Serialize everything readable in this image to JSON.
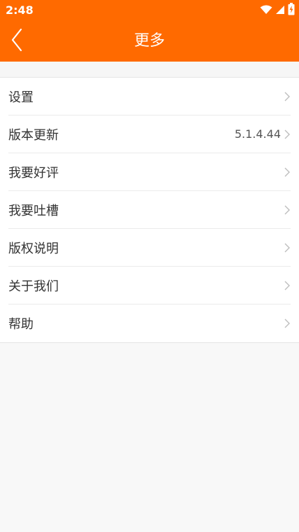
{
  "status_bar": {
    "time": "2:48",
    "icons": [
      "wifi-icon",
      "signal-icon",
      "battery-charging-icon"
    ]
  },
  "header": {
    "title": "更多",
    "back_icon": "chevron-left-icon"
  },
  "colors": {
    "accent": "#ff6a00",
    "background": "#f8f8f8",
    "item_text": "#333333",
    "chevron": "#bdbdbd"
  },
  "menu": {
    "items": [
      {
        "label": "设置",
        "value": ""
      },
      {
        "label": "版本更新",
        "value": "5.1.4.44"
      },
      {
        "label": "我要好评",
        "value": ""
      },
      {
        "label": "我要吐槽",
        "value": ""
      },
      {
        "label": "版权说明",
        "value": ""
      },
      {
        "label": "关于我们",
        "value": ""
      },
      {
        "label": "帮助",
        "value": ""
      }
    ]
  }
}
